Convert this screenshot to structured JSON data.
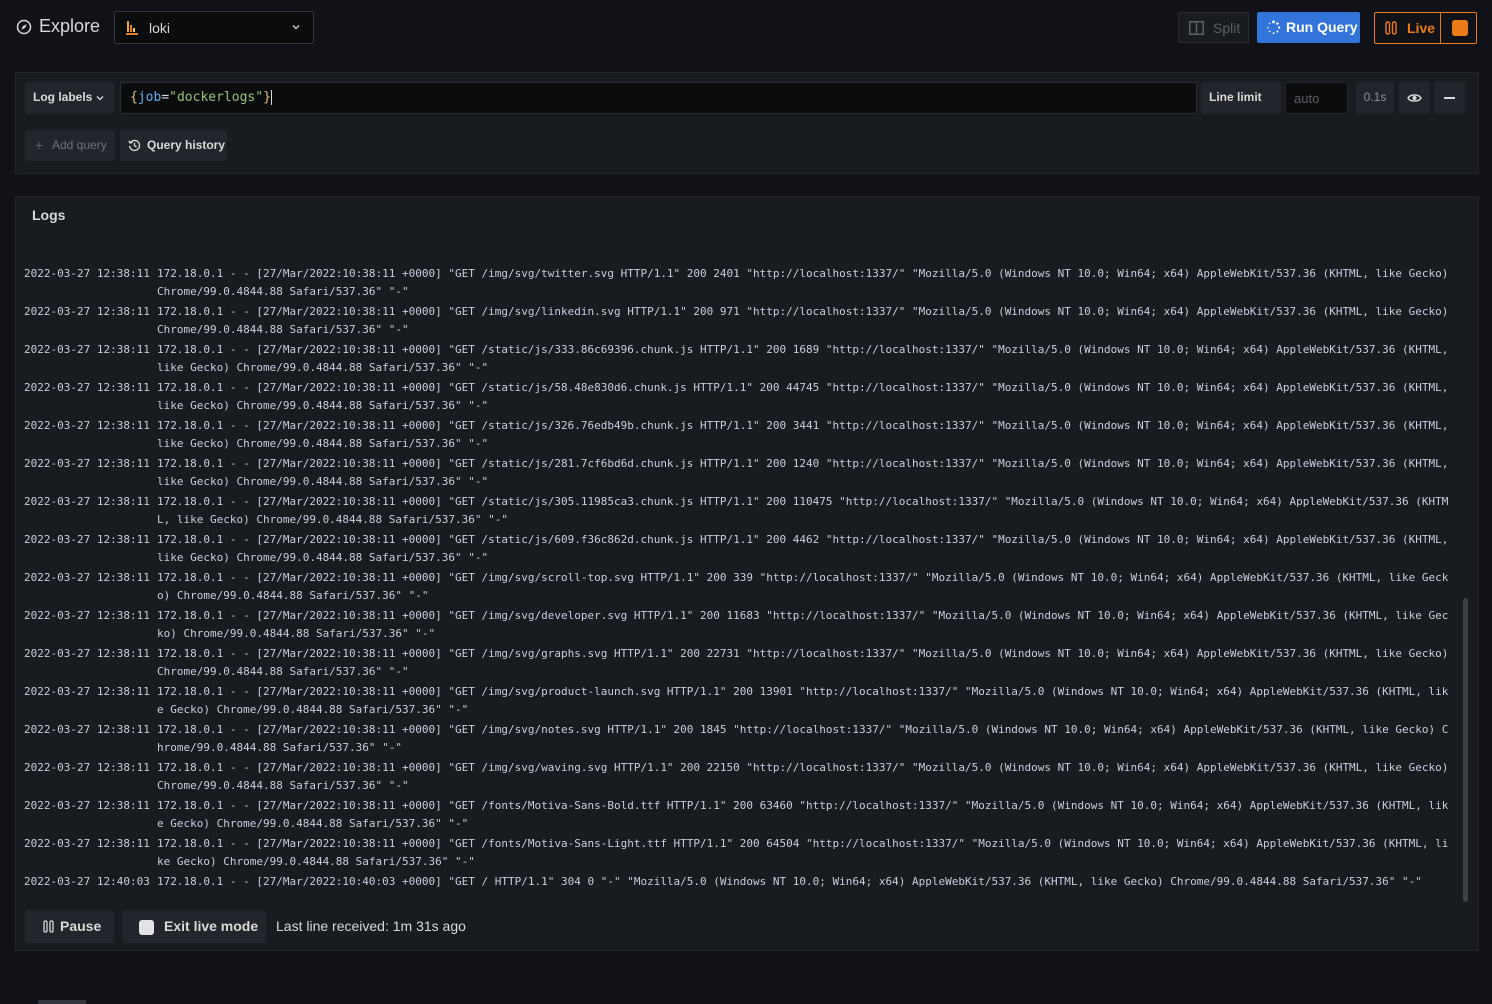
{
  "header": {
    "title": "Explore",
    "datasource": "loki",
    "split_label": "Split",
    "run_query_label": "Run Query",
    "live_label": "Live"
  },
  "query": {
    "log_labels_label": "Log labels",
    "expr_open": "{",
    "expr_key": "job",
    "expr_eq": "=",
    "expr_value": "\"dockerlogs\"",
    "expr_close": "}",
    "line_limit_label": "Line limit",
    "line_limit_placeholder": "auto",
    "query_time": "0.1s",
    "add_query_label": "Add query",
    "query_history_label": "Query history"
  },
  "logs": {
    "title": "Logs",
    "pause_label": "Pause",
    "exit_live_label": "Exit live mode",
    "last_line_received": "Last line received: 1m 31s ago",
    "rows": [
      {
        "ts": "",
        "line": "Mozilla/5.0 (Windows NT 10.0; Win64; x64) AppleWebKit/537.36 (KHTML, like Gecko) Chrome/99.0.4844.88 Safari/537.36\" \"-\""
      },
      {
        "ts": "2022-03-27 12:38:11",
        "line": "172.18.0.1 - - [27/Mar/2022:10:38:11 +0000] \"GET /img/svg/twitter.svg HTTP/1.1\" 200 2401 \"http://localhost:1337/\" \"Mozilla/5.0 (Windows NT 10.0; Win64; x64) AppleWebKit/537.36 (KHTML, like Gecko) Chrome/99.0.4844.88 Safari/537.36\" \"-\""
      },
      {
        "ts": "2022-03-27 12:38:11",
        "line": "172.18.0.1 - - [27/Mar/2022:10:38:11 +0000] \"GET /img/svg/linkedin.svg HTTP/1.1\" 200 971 \"http://localhost:1337/\" \"Mozilla/5.0 (Windows NT 10.0; Win64; x64) AppleWebKit/537.36 (KHTML, like Gecko) Chrome/99.0.4844.88 Safari/537.36\" \"-\""
      },
      {
        "ts": "2022-03-27 12:38:11",
        "line": "172.18.0.1 - - [27/Mar/2022:10:38:11 +0000] \"GET /static/js/333.86c69396.chunk.js HTTP/1.1\" 200 1689 \"http://localhost:1337/\" \"Mozilla/5.0 (Windows NT 10.0; Win64; x64) AppleWebKit/537.36 (KHTML, like Gecko) Chrome/99.0.4844.88 Safari/537.36\" \"-\""
      },
      {
        "ts": "2022-03-27 12:38:11",
        "line": "172.18.0.1 - - [27/Mar/2022:10:38:11 +0000] \"GET /static/js/58.48e830d6.chunk.js HTTP/1.1\" 200 44745 \"http://localhost:1337/\" \"Mozilla/5.0 (Windows NT 10.0; Win64; x64) AppleWebKit/537.36 (KHTML, like Gecko) Chrome/99.0.4844.88 Safari/537.36\" \"-\""
      },
      {
        "ts": "2022-03-27 12:38:11",
        "line": "172.18.0.1 - - [27/Mar/2022:10:38:11 +0000] \"GET /static/js/326.76edb49b.chunk.js HTTP/1.1\" 200 3441 \"http://localhost:1337/\" \"Mozilla/5.0 (Windows NT 10.0; Win64; x64) AppleWebKit/537.36 (KHTML, like Gecko) Chrome/99.0.4844.88 Safari/537.36\" \"-\""
      },
      {
        "ts": "2022-03-27 12:38:11",
        "line": "172.18.0.1 - - [27/Mar/2022:10:38:11 +0000] \"GET /static/js/281.7cf6bd6d.chunk.js HTTP/1.1\" 200 1240 \"http://localhost:1337/\" \"Mozilla/5.0 (Windows NT 10.0; Win64; x64) AppleWebKit/537.36 (KHTML, like Gecko) Chrome/99.0.4844.88 Safari/537.36\" \"-\""
      },
      {
        "ts": "2022-03-27 12:38:11",
        "line": "172.18.0.1 - - [27/Mar/2022:10:38:11 +0000] \"GET /static/js/305.11985ca3.chunk.js HTTP/1.1\" 200 110475 \"http://localhost:1337/\" \"Mozilla/5.0 (Windows NT 10.0; Win64; x64) AppleWebKit/537.36 (KHTML, like Gecko) Chrome/99.0.4844.88 Safari/537.36\" \"-\""
      },
      {
        "ts": "2022-03-27 12:38:11",
        "line": "172.18.0.1 - - [27/Mar/2022:10:38:11 +0000] \"GET /static/js/609.f36c862d.chunk.js HTTP/1.1\" 200 4462 \"http://localhost:1337/\" \"Mozilla/5.0 (Windows NT 10.0; Win64; x64) AppleWebKit/537.36 (KHTML, like Gecko) Chrome/99.0.4844.88 Safari/537.36\" \"-\""
      },
      {
        "ts": "2022-03-27 12:38:11",
        "line": "172.18.0.1 - - [27/Mar/2022:10:38:11 +0000] \"GET /img/svg/scroll-top.svg HTTP/1.1\" 200 339 \"http://localhost:1337/\" \"Mozilla/5.0 (Windows NT 10.0; Win64; x64) AppleWebKit/537.36 (KHTML, like Gecko) Chrome/99.0.4844.88 Safari/537.36\" \"-\""
      },
      {
        "ts": "2022-03-27 12:38:11",
        "line": "172.18.0.1 - - [27/Mar/2022:10:38:11 +0000] \"GET /img/svg/developer.svg HTTP/1.1\" 200 11683 \"http://localhost:1337/\" \"Mozilla/5.0 (Windows NT 10.0; Win64; x64) AppleWebKit/537.36 (KHTML, like Gecko) Chrome/99.0.4844.88 Safari/537.36\" \"-\""
      },
      {
        "ts": "2022-03-27 12:38:11",
        "line": "172.18.0.1 - - [27/Mar/2022:10:38:11 +0000] \"GET /img/svg/graphs.svg HTTP/1.1\" 200 22731 \"http://localhost:1337/\" \"Mozilla/5.0 (Windows NT 10.0; Win64; x64) AppleWebKit/537.36 (KHTML, like Gecko) Chrome/99.0.4844.88 Safari/537.36\" \"-\""
      },
      {
        "ts": "2022-03-27 12:38:11",
        "line": "172.18.0.1 - - [27/Mar/2022:10:38:11 +0000] \"GET /img/svg/product-launch.svg HTTP/1.1\" 200 13901 \"http://localhost:1337/\" \"Mozilla/5.0 (Windows NT 10.0; Win64; x64) AppleWebKit/537.36 (KHTML, like Gecko) Chrome/99.0.4844.88 Safari/537.36\" \"-\""
      },
      {
        "ts": "2022-03-27 12:38:11",
        "line": "172.18.0.1 - - [27/Mar/2022:10:38:11 +0000] \"GET /img/svg/notes.svg HTTP/1.1\" 200 1845 \"http://localhost:1337/\" \"Mozilla/5.0 (Windows NT 10.0; Win64; x64) AppleWebKit/537.36 (KHTML, like Gecko) Chrome/99.0.4844.88 Safari/537.36\" \"-\""
      },
      {
        "ts": "2022-03-27 12:38:11",
        "line": "172.18.0.1 - - [27/Mar/2022:10:38:11 +0000] \"GET /img/svg/waving.svg HTTP/1.1\" 200 22150 \"http://localhost:1337/\" \"Mozilla/5.0 (Windows NT 10.0; Win64; x64) AppleWebKit/537.36 (KHTML, like Gecko) Chrome/99.0.4844.88 Safari/537.36\" \"-\""
      },
      {
        "ts": "2022-03-27 12:38:11",
        "line": "172.18.0.1 - - [27/Mar/2022:10:38:11 +0000] \"GET /fonts/Motiva-Sans-Bold.ttf HTTP/1.1\" 200 63460 \"http://localhost:1337/\" \"Mozilla/5.0 (Windows NT 10.0; Win64; x64) AppleWebKit/537.36 (KHTML, like Gecko) Chrome/99.0.4844.88 Safari/537.36\" \"-\""
      },
      {
        "ts": "2022-03-27 12:38:11",
        "line": "172.18.0.1 - - [27/Mar/2022:10:38:11 +0000] \"GET /fonts/Motiva-Sans-Light.ttf HTTP/1.1\" 200 64504 \"http://localhost:1337/\" \"Mozilla/5.0 (Windows NT 10.0; Win64; x64) AppleWebKit/537.36 (KHTML, like Gecko) Chrome/99.0.4844.88 Safari/537.36\" \"-\""
      },
      {
        "ts": "2022-03-27 12:40:03",
        "line": "172.18.0.1 - - [27/Mar/2022:10:40:03 +0000] \"GET / HTTP/1.1\" 304 0 \"-\" \"Mozilla/5.0 (Windows NT 10.0; Win64; x64) AppleWebKit/537.36 (KHTML, like Gecko) Chrome/99.0.4844.88 Safari/537.36\" \"-\""
      }
    ]
  },
  "colors": {
    "run_query": "#3274d9",
    "live": "#eb7b18",
    "background": "#111217",
    "panel": "#181b1f"
  },
  "icons": [
    "compass-icon",
    "loki-logo-icon",
    "chevron-down-icon",
    "split-icon",
    "refresh-icon",
    "pause-icon",
    "stop-icon",
    "eye-icon",
    "minus-icon",
    "plus-icon",
    "history-icon",
    "checkbox-icon"
  ]
}
